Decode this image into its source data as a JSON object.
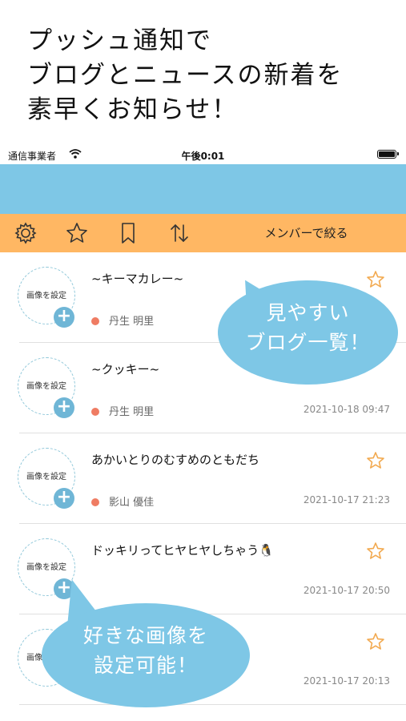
{
  "promo": {
    "line1": "プッシュ通知で",
    "line2": "ブログとニュースの新着を",
    "line3": "素早くお知らせ！"
  },
  "status_bar": {
    "carrier": "通信事業者",
    "time": "午後0:01"
  },
  "toolbar": {
    "filter_label": "メンバーで絞る",
    "icons": [
      "gear-icon",
      "star-outline-icon",
      "bookmark-icon",
      "sort-icon"
    ]
  },
  "list": {
    "thumb_label": "画像を設定",
    "items": [
      {
        "title": "~キーマカレー~",
        "author": "丹生 明里",
        "date": ""
      },
      {
        "title": "~クッキー~",
        "author": "丹生 明里",
        "date": "2021-10-18 09:47"
      },
      {
        "title": "あかいとりのむすめのともだち",
        "author": "影山 優佳",
        "date": "2021-10-17 21:23"
      },
      {
        "title": "ドッキリってヒヤヒヤしちゃう🐧",
        "author": "",
        "date": "2021-10-17 20:50"
      },
      {
        "title": "",
        "author": "",
        "date": "2021-10-17 20:13"
      }
    ]
  },
  "callouts": {
    "bubble1_line1": "見やすい",
    "bubble1_line2": "ブログ一覧！",
    "bubble2_line1": "好きな画像を",
    "bubble2_line2": "設定可能！"
  },
  "colors": {
    "navbar": "#7ec7e6",
    "toolbar": "#ffb763",
    "accent_star": "#f2a94f",
    "author_dot": "#ef7c63"
  }
}
